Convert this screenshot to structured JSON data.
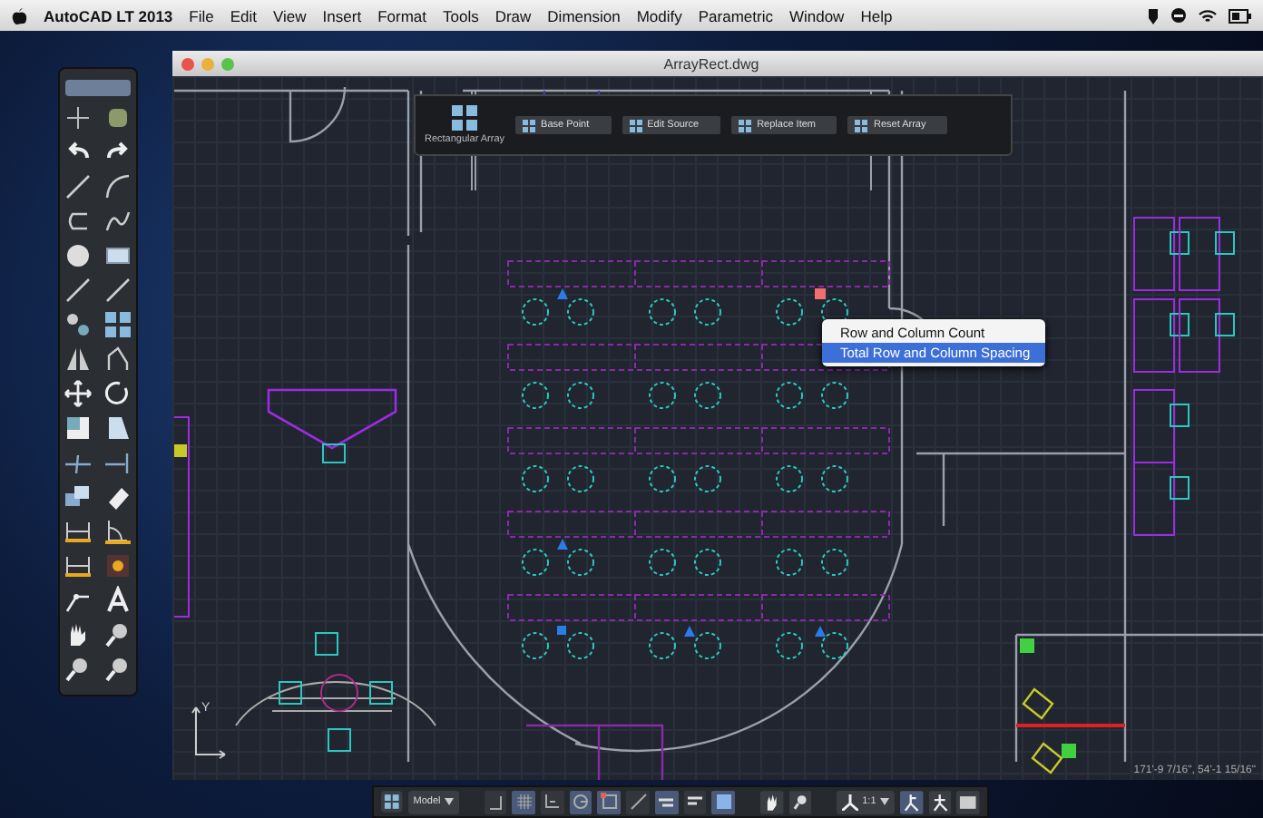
{
  "menu_bar": {
    "app": "AutoCAD LT 2013",
    "items": [
      "File",
      "Edit",
      "View",
      "Insert",
      "Format",
      "Tools",
      "Draw",
      "Dimension",
      "Modify",
      "Parametric",
      "Window",
      "Help"
    ]
  },
  "window": {
    "title": "ArrayRect.dwg"
  },
  "array_toolbar": {
    "label": "Rectangular Array",
    "buttons": [
      "Base Point",
      "Edit Source",
      "Replace Item",
      "Reset Array"
    ]
  },
  "context_menu": {
    "items": [
      {
        "label": "Row and Column Count",
        "selected": false
      },
      {
        "label": "Total Row and Column Spacing",
        "selected": true
      }
    ]
  },
  "ucs_axis": "Y",
  "coordinates": "171'-9 7/16\", 54'-1 15/16\"",
  "status_bar": {
    "layout": "Model",
    "scale": "1:1",
    "toggles": [
      {
        "kind": "snap",
        "on": false
      },
      {
        "kind": "grid",
        "on": true
      },
      {
        "kind": "ortho",
        "on": false
      },
      {
        "kind": "polar",
        "on": true
      },
      {
        "kind": "osnap",
        "on": true
      },
      {
        "kind": "otrack",
        "on": false
      },
      {
        "kind": "dyn",
        "on": true
      },
      {
        "kind": "lineweight",
        "on": false
      },
      {
        "kind": "transparency",
        "on": true
      }
    ]
  }
}
